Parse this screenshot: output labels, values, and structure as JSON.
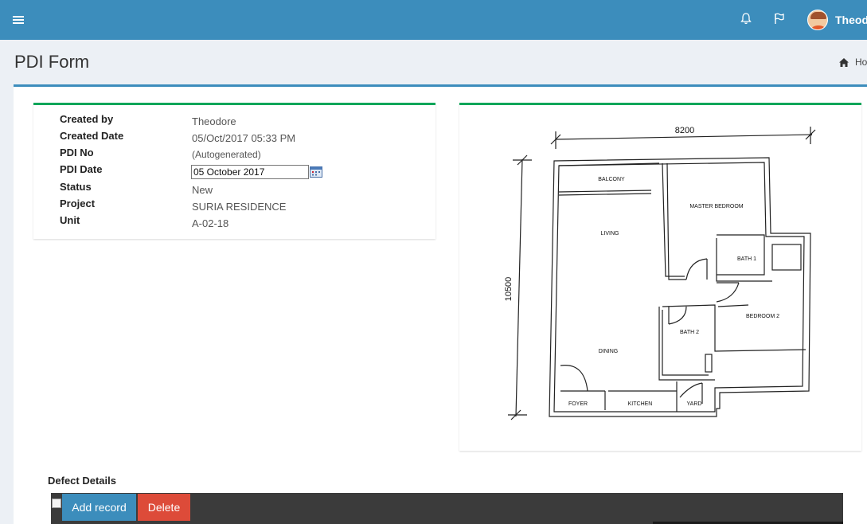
{
  "header": {
    "user_name": "Theodore",
    "icons": [
      "menu-icon",
      "bell-icon",
      "flag-icon",
      "avatar"
    ],
    "brand_color": "#3c8dbc"
  },
  "page": {
    "title": "PDI Form",
    "breadcrumb": "Ho"
  },
  "pdi": {
    "fields": [
      {
        "label": "Created by",
        "value": "Theodore"
      },
      {
        "label": "Created Date",
        "value": "05/Oct/2017 05:33 PM"
      },
      {
        "label": "PDI No",
        "value": "(Autogenerated)"
      },
      {
        "label": "PDI Date",
        "value": "05 October 2017"
      },
      {
        "label": "Status",
        "value": "New"
      },
      {
        "label": "Project",
        "value": "SURIA RESIDENCE"
      },
      {
        "label": "Unit",
        "value": "A-02-18"
      }
    ],
    "accent_color": "#00a65a"
  },
  "floorplan": {
    "dim_width": "8200",
    "dim_height": "10500",
    "rooms": {
      "balcony": "BALCONY",
      "master_bedroom": "MASTER BEDROOM",
      "living": "LIVING",
      "bath1": "BATH 1",
      "bedroom2": "BEDROOM 2",
      "bath2": "BATH 2",
      "dining": "DINING",
      "foyer": "FOYER",
      "kitchen": "KITCHEN",
      "yard": "YARD"
    }
  },
  "defects": {
    "title": "Defect Details",
    "add_label": "Add record",
    "delete_label": "Delete",
    "add_color": "#3c8dbc",
    "delete_color": "#dd4b39"
  }
}
